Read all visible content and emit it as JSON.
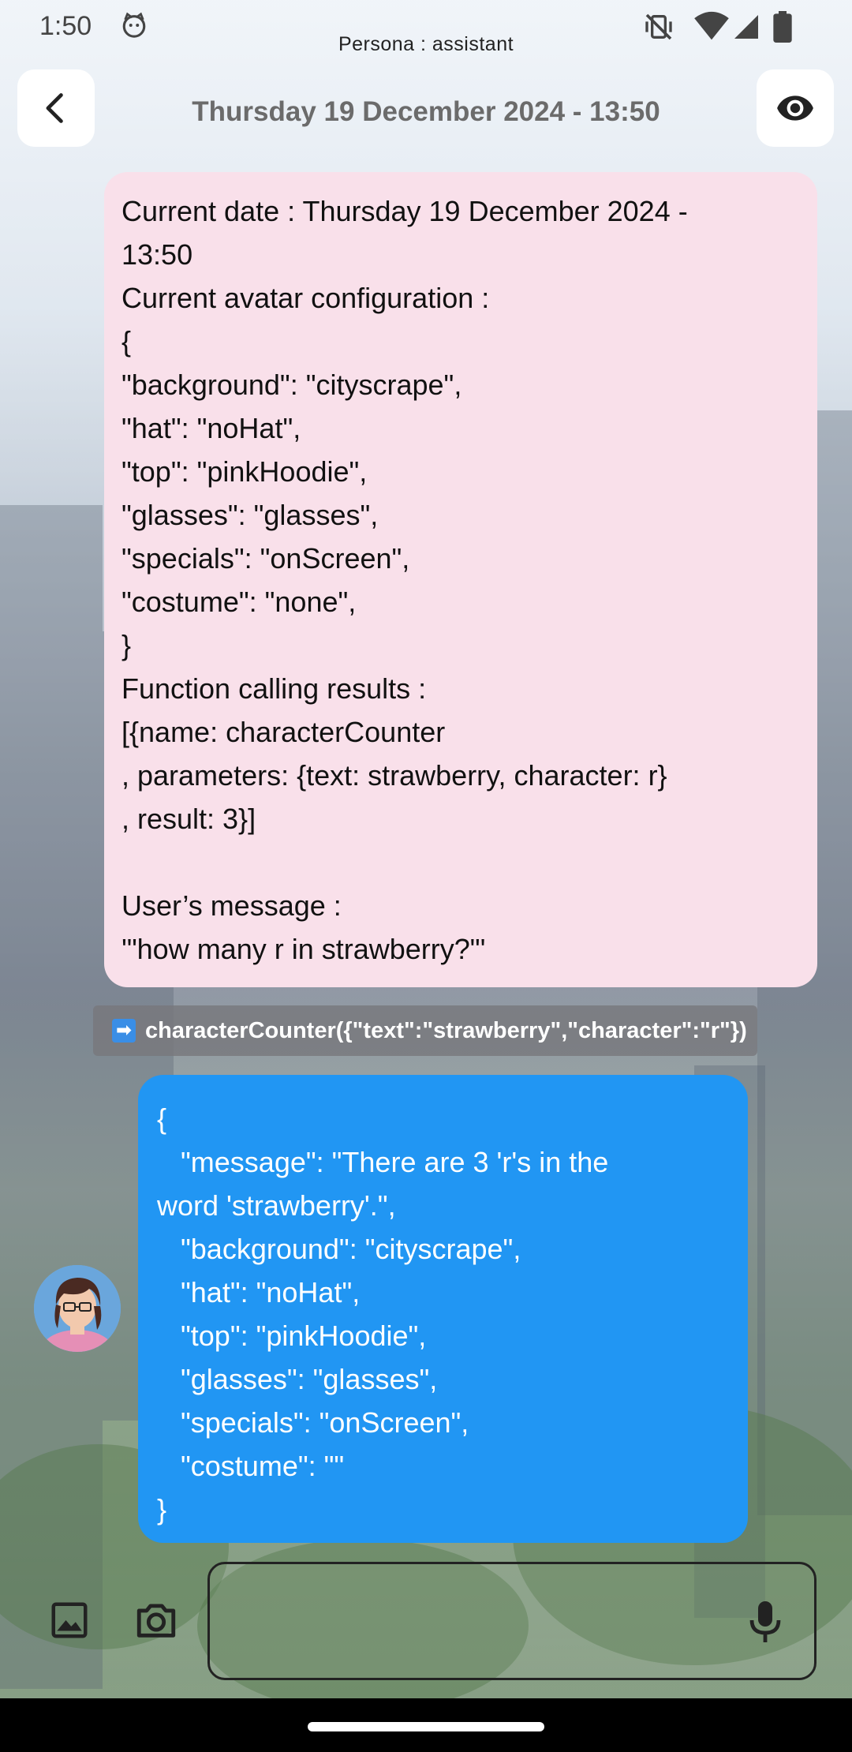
{
  "status_bar": {
    "time": "1:50",
    "persona_label": "Persona : assistant",
    "icons": [
      "cat-face-icon",
      "vibrate-off-icon",
      "wifi-icon",
      "signal-icon",
      "battery-icon"
    ]
  },
  "header": {
    "title": "Thursday 19 December 2024 - 13:50",
    "back_icon": "chevron-left-icon",
    "view_icon": "eye-icon"
  },
  "user_message": {
    "lines": [
      "Current date : Thursday 19 December 2024 -",
      "13:50",
      "Current avatar configuration :",
      "{",
      "\"background\": \"cityscrape\",",
      "\"hat\": \"noHat\",",
      "\"top\": \"pinkHoodie\",",
      "\"glasses\": \"glasses\",",
      "\"specials\": \"onScreen\",",
      "\"costume\": \"none\",",
      "}",
      "Function calling results :",
      "[{name: characterCounter",
      ", parameters: {text: strawberry, character: r}",
      ", result: 3}]",
      "",
      "User’s message :",
      "'\"how many r in strawberry?\"'"
    ]
  },
  "function_call": {
    "icon": "right-arrow-icon",
    "text": "characterCounter({\"text\":\"strawberry\",\"character\":\"r\"})"
  },
  "bot_message": {
    "lines": [
      "{",
      "   \"message\": \"There are 3 'r's in the",
      "word 'strawberry'.\",",
      "   \"background\": \"cityscrape\",",
      "   \"hat\": \"noHat\",",
      "   \"top\": \"pinkHoodie\",",
      "   \"glasses\": \"glasses\",",
      "   \"specials\": \"onScreen\",",
      "   \"costume\": \"\"",
      "}"
    ]
  },
  "input_bar": {
    "placeholder": "",
    "icons": [
      "image-icon",
      "camera-icon",
      "microphone-icon"
    ]
  },
  "colors": {
    "user_bubble": "#f9e0ea",
    "bot_bubble": "#2196f3",
    "function_chip": "#78787d"
  }
}
